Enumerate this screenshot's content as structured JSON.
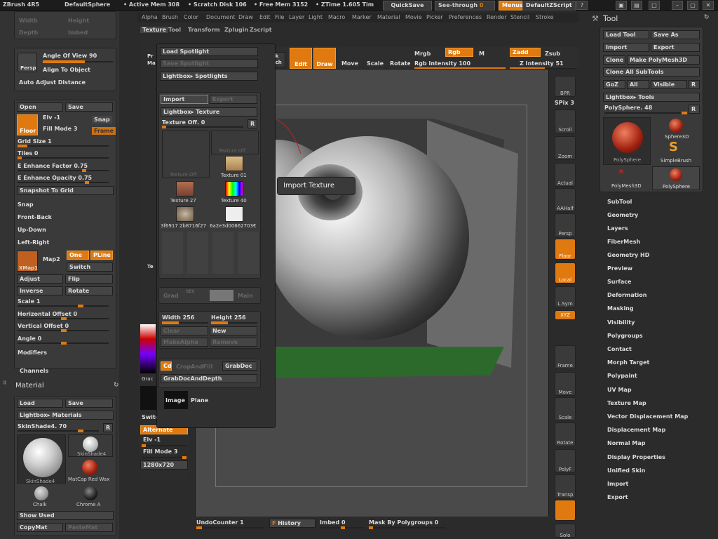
{
  "topbar": {
    "app": "ZBrush 4R5",
    "doc": "DefaultSphere",
    "active_mem": "• Active Mem 308",
    "scratch": "• Scratch Disk 106",
    "free_mem": "• Free Mem 3152",
    "ztime": "• ZTime 1.605 Tim",
    "quicksave": "QuickSave",
    "seethrough": "See-through",
    "seethrough_val": "0",
    "menus": "Menus",
    "script": "DefaultZScript"
  },
  "menubar": [
    "Alpha",
    "Brush",
    "Color",
    "Document",
    "Draw",
    "Edit",
    "File",
    "Layer",
    "Light",
    "Macro",
    "Marker",
    "Material",
    "Movie",
    "Picker",
    "Preferences",
    "Render",
    "Stencil",
    "Stroke"
  ],
  "submenu": [
    "Texture",
    "Tool",
    "Transform",
    "Zplugin",
    "Zscript"
  ],
  "shelf": {
    "edit": "Edit",
    "draw": "Draw",
    "move": "Move",
    "scale": "Scale",
    "rotate": "Rotate",
    "mrgb": "Mrgb",
    "rgb": "Rgb",
    "m": "M",
    "zadd": "Zadd",
    "zsub": "Zsub",
    "rgb_intensity": "Rgb Intensity 100",
    "z_intensity": "Z Intensity 51",
    "quick": "Quick",
    "sketch": "Sketch"
  },
  "left": {
    "width": "Width",
    "height": "Height",
    "depth": "Depth",
    "imbed": "Imbed",
    "persp": "Persp",
    "angle_of_view": "Angle Of View 90",
    "align": "Align To Object",
    "auto_adjust": "Auto Adjust Distance",
    "open": "Open",
    "save": "Save",
    "elv": "Elv -1",
    "snap": "Snap",
    "floor": "Floor",
    "fill_mode": "Fill Mode 3",
    "frame": "Frame",
    "grid_size": "Grid Size 1",
    "tiles": "Tiles 0",
    "enhance_factor": "E Enhance Factor 0.75",
    "enhance_opacity": "E Enhance Opacity 0.75",
    "snapshot": "Snapshot To Grid",
    "snap2": "Snap",
    "front_back": "Front-Back",
    "up_down": "Up-Down",
    "left_right": "Left-Right",
    "xmap": "XMap1",
    "map2": "Map2",
    "one": "One",
    "pline": "PLine",
    "switch": "Switch",
    "adjust": "Adjust",
    "flip": "Flip",
    "inverse": "Inverse",
    "rotate": "Rotate",
    "scale": "Scale 1",
    "h_offset": "Horizontal Offset 0",
    "v_offset": "Vertical Offset 0",
    "angle": "Angle 0",
    "modifiers": "Modifiers",
    "channels": "Channels"
  },
  "material": {
    "title": "Material",
    "load": "Load",
    "save": "Save",
    "lightbox": "Lightbox▸ Materials",
    "skinshade": "SkinShade4. 70",
    "r": "R",
    "items": [
      "SkinShade4",
      "SkinShade4",
      "MatCap Red Wax",
      "Chalk",
      "Chrome A"
    ],
    "show_used": "Show Used",
    "copymat": "CopyMat",
    "pastemat": "PasteMat"
  },
  "popup": {
    "load_spotlight": "Load Spotlight",
    "save_spotlight": "Save Spotlight",
    "lightbox_spotlights": "Lightbox▸ Spotlights",
    "import": "Import",
    "export": "Export",
    "lightbox_texture": "Lightbox▸ Texture",
    "texture_off": "Texture Off. 0",
    "r": "R",
    "tex": [
      "Texture Off",
      "Texture Off",
      "Texture 01",
      "Texture 27",
      "Texture 40",
      "3f6917 2b8716f27",
      "6a2e3d00662703€"
    ],
    "grad": "Grad",
    "sec": "SEC",
    "main": "Main",
    "width": "Width 256",
    "height": "Height 256",
    "clear": "Clear",
    "new": "New",
    "makealpha": "MakeAlpha",
    "remove": "Remove",
    "cd": "Cd",
    "crop": "CropAndFill",
    "grabdoc": "GrabDoc",
    "grabdocdepth": "GrabDocAndDepth",
    "image": "Image",
    "plane": "Plane",
    "switchcolor": "SwitchColor",
    "alternate": "Alternate",
    "elv": "Elv -1",
    "fill_mode": "Fill Mode 3",
    "res": "1280x720",
    "pr": "Pr",
    "ma": "Ma",
    "te": "Te",
    "brac": "Grac"
  },
  "tooltip": "Import Texture",
  "rtools": [
    "BPR",
    "SPix 3",
    "Scroll",
    "Zoom",
    "Actual",
    "AAHalf",
    "Persp",
    "Floor",
    "Local",
    "L.Sym",
    "XYZ",
    "Frame",
    "Move",
    "Scale",
    "Rotate",
    "PolyF",
    "Transp",
    "Solo"
  ],
  "tool": {
    "title": "Tool",
    "load": "Load Tool",
    "saveas": "Save As",
    "import": "Import",
    "export": "Export",
    "clone": "Clone",
    "make": "Make PolyMesh3D",
    "clone_all": "Clone All SubTools",
    "goz": "GoZ",
    "all": "All",
    "visible": "Visible",
    "r": "R",
    "lightbox": "Lightbox▸ Tools",
    "polysphere": "PolySphere. 48",
    "items": [
      "PolySphere",
      "Sphere3D",
      "SimpleBrush",
      "PolyMesh3D",
      "PolySphere"
    ]
  },
  "menulist": [
    "SubTool",
    "Geometry",
    "Layers",
    "FiberMesh",
    "Geometry HD",
    "Preview",
    "Surface",
    "Deformation",
    "Masking",
    "Visibility",
    "Polygroups",
    "Contact",
    "Morph Target",
    "Polypaint",
    "UV Map",
    "Texture Map",
    "Vector Displacement Map",
    "Displacement Map",
    "Normal Map",
    "Display Properties",
    "Unified Skin",
    "Import",
    "Export"
  ],
  "bottom": {
    "undo": "UndoCounter 1",
    "history": "History",
    "f": "F",
    "imbed": "Imbed 0",
    "mask": "Mask By Polygroups 0"
  },
  "colors": {
    "accent": "#e07a10",
    "panel": "#3a3a3a",
    "bg": "#2b2b2b"
  }
}
